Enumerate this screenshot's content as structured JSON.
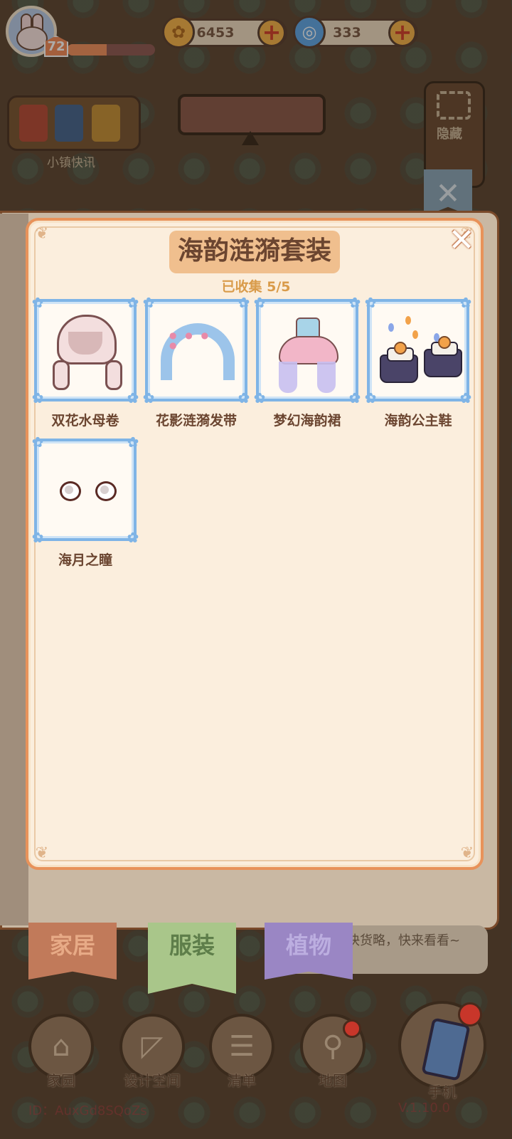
{
  "player": {
    "level": "72",
    "xp_fraction": 0.45
  },
  "currencies": {
    "coins": "6453",
    "shells": "333"
  },
  "icons": {
    "avatar": "bunny-avatar-icon",
    "coin": "coin-icon",
    "shell": "shell-icon",
    "plus": "plus-icon",
    "hide": "fullscreen-icon",
    "close": "close-icon"
  },
  "hud": {
    "news_label": "小镇快讯",
    "hide_label": "隐藏"
  },
  "set_panel": {
    "title": "海韵涟漪套装",
    "collected": "已收集 5/5",
    "items": [
      {
        "name": "双花水母卷",
        "icon": "hair-icon"
      },
      {
        "name": "花影涟漪发带",
        "icon": "headband-icon"
      },
      {
        "name": "梦幻海韵裙",
        "icon": "dress-icon"
      },
      {
        "name": "海韵公主鞋",
        "icon": "shoes-icon"
      },
      {
        "name": "海月之瞳",
        "icon": "eyes-icon"
      }
    ]
  },
  "tabs": {
    "home": "家居",
    "clothing": "服装",
    "plants": "植物"
  },
  "speech": "快货略，快来看看~",
  "nav": {
    "home": "家园",
    "design": "设计空间",
    "list": "清单",
    "map": "地图",
    "phone": "手机"
  },
  "footer": {
    "id": "ID：AuxGd8SQoZs",
    "version": "V.1.10.0"
  },
  "colors": {
    "accent": "#e8925a",
    "frame": "#7fb4e6",
    "title_bg": "#f0bf8e",
    "text": "#6b4530"
  }
}
